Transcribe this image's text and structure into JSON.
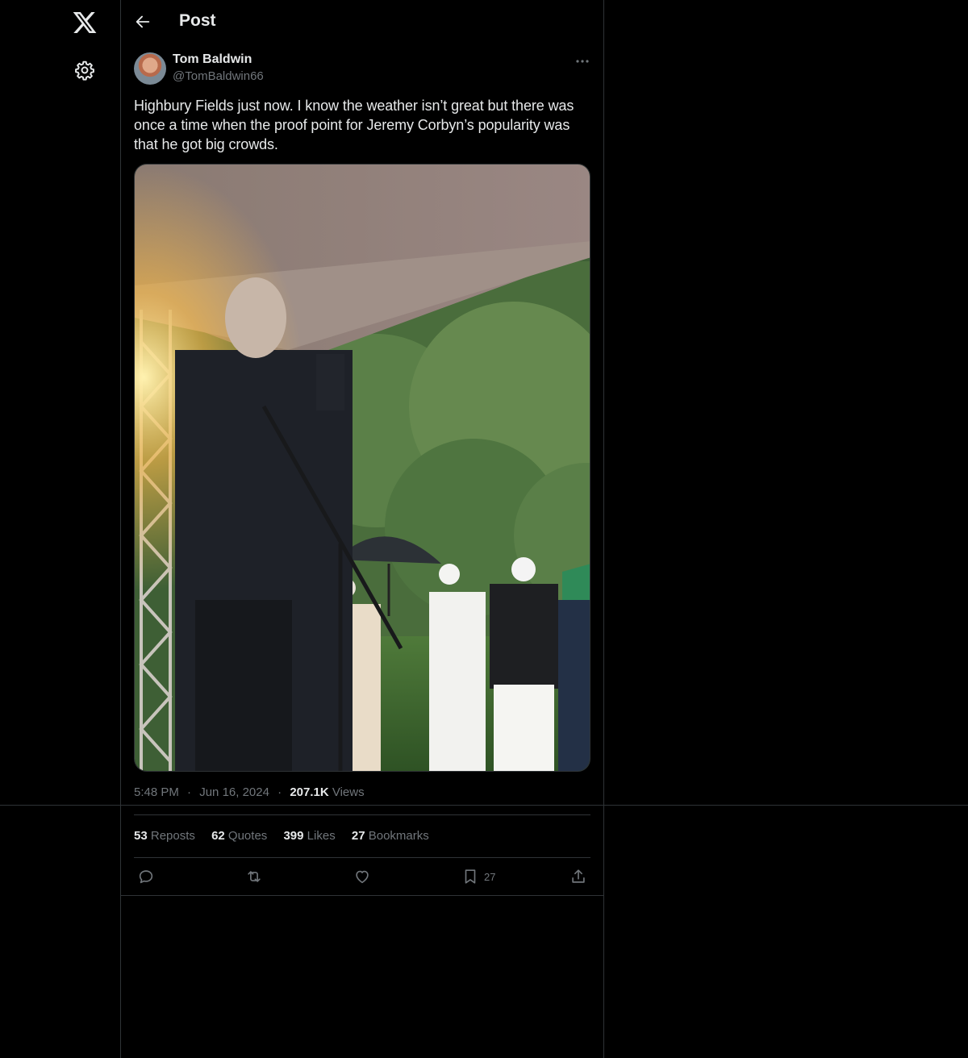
{
  "nav": {
    "logo_icon": "x-logo-icon",
    "settings_icon": "gear-icon"
  },
  "header": {
    "title": "Post",
    "back_icon": "arrow-left-icon"
  },
  "post": {
    "author_name": "Tom Baldwin",
    "author_handle": "@TomBaldwin66",
    "text": "Highbury Fields just now. I know the weather isn’t great but there was once a time when the proof point for Jeremy Corbyn’s popularity was that he got big crowds.",
    "time": "5:48 PM",
    "separator": "·",
    "date": "Jun 16, 2024",
    "views_count": "207.1K",
    "views_label": "Views"
  },
  "stats": {
    "reposts_count": "53",
    "reposts_label": "Reposts",
    "quotes_count": "62",
    "quotes_label": "Quotes",
    "likes_count": "399",
    "likes_label": "Likes",
    "bookmarks_count": "27",
    "bookmarks_label": "Bookmarks"
  },
  "actions": {
    "reply_icon": "reply-icon",
    "repost_icon": "repost-icon",
    "like_icon": "heart-icon",
    "bookmark_icon": "bookmark-icon",
    "bookmark_count": "27",
    "share_icon": "share-icon"
  },
  "colors": {
    "background": "#000000",
    "text": "#e7e9ea",
    "muted": "#71767b",
    "divider": "#2f3336"
  }
}
